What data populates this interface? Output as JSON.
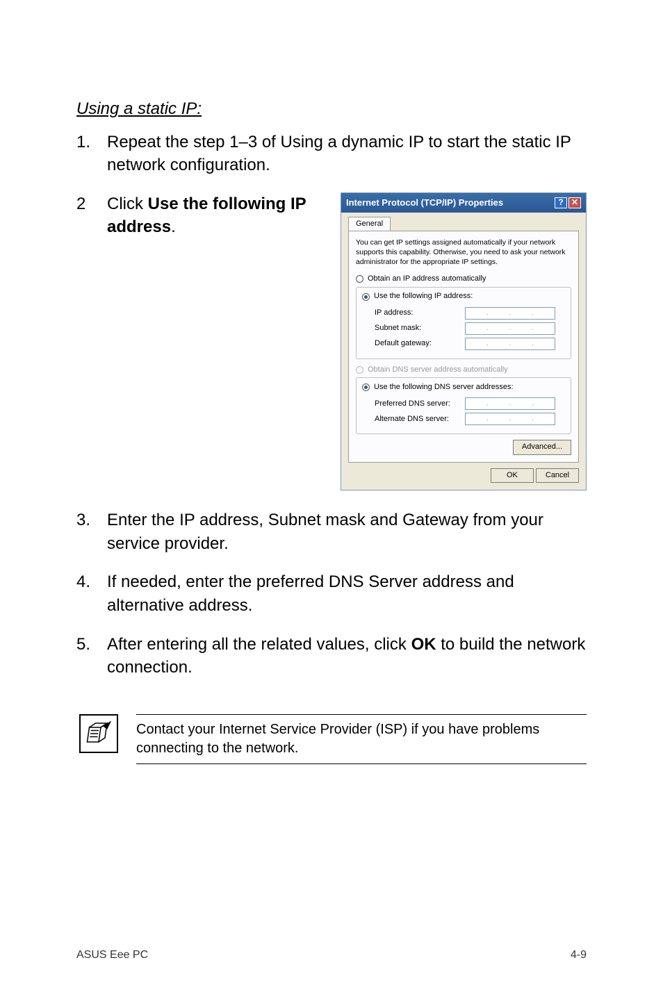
{
  "heading": "Using a static IP:",
  "steps": {
    "s1": {
      "num": "1.",
      "text_a": "Repeat the step 1–3 of Using a dynamic IP to start the static IP network configuration."
    },
    "s2": {
      "num": "2",
      "text_a": "Click ",
      "bold": "Use the following IP address",
      "text_b": "."
    },
    "s3": {
      "num": "3.",
      "text_a": "Enter the IP address, Subnet mask and Gateway from your service provider."
    },
    "s4": {
      "num": "4.",
      "text_a": "If needed, enter the preferred DNS Server address and alternative address."
    },
    "s5": {
      "num": "5.",
      "text_a": "After entering all the related values, click ",
      "bold": "OK",
      "text_b": " to build the network connection."
    }
  },
  "note": "Contact your Internet Service Provider (ISP) if you have problems connecting to the network.",
  "footer": {
    "left": "ASUS Eee PC",
    "right": "4-9"
  },
  "dialog": {
    "title": "Internet Protocol (TCP/IP) Properties",
    "tab": "General",
    "desc": "You can get IP settings assigned automatically if your network supports this capability. Otherwise, you need to ask your network administrator for the appropriate IP settings.",
    "r1": "Obtain an IP address automatically",
    "r2": "Use the following IP address:",
    "f_ip": "IP address:",
    "f_mask": "Subnet mask:",
    "f_gw": "Default gateway:",
    "r3": "Obtain DNS server address automatically",
    "r4": "Use the following DNS server addresses:",
    "f_dns1": "Preferred DNS server:",
    "f_dns2": "Alternate DNS server:",
    "adv": "Advanced...",
    "ok": "OK",
    "cancel": "Cancel"
  }
}
